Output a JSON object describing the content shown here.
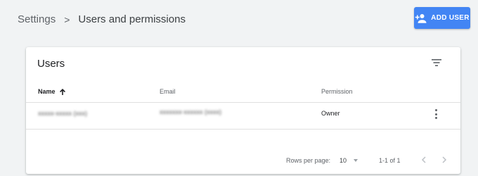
{
  "breadcrumb": {
    "parent": "Settings",
    "separator": ">",
    "current": "Users and permissions"
  },
  "header": {
    "add_user_label": "ADD USER",
    "add_user_icon": "person-add-icon",
    "accent_color": "#4285f4"
  },
  "card": {
    "title": "Users",
    "filter_icon": "filter-list-icon",
    "columns": [
      {
        "label": "Name",
        "sorted": "ascending"
      },
      {
        "label": "Email"
      },
      {
        "label": "Permission"
      }
    ],
    "rows": [
      {
        "name": "xxxxx-xxxxx (xxx)",
        "email": "xxxxxxx-xxxxxx (xxxx)",
        "permission": "Owner",
        "redacted": true
      }
    ],
    "footer": {
      "rows_per_page_label": "Rows per page:",
      "rows_per_page_value": "10",
      "range_label": "1-1 of 1"
    }
  }
}
